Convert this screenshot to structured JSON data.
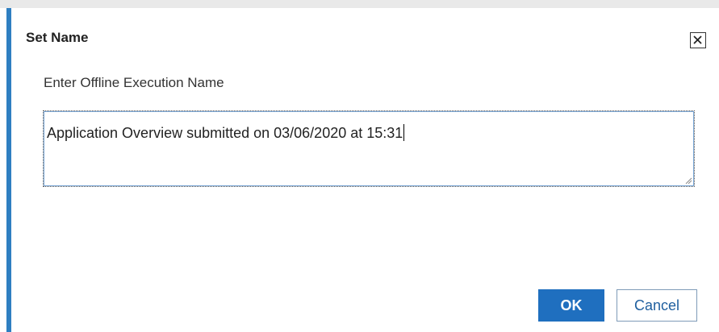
{
  "dialog": {
    "title": "Set Name",
    "close_icon": "close-icon"
  },
  "form": {
    "prompt_label": "Enter Offline Execution Name",
    "name_value": "Application Overview submitted on 03/06/2020 at 15:31"
  },
  "buttons": {
    "ok_label": "OK",
    "cancel_label": "Cancel"
  },
  "colors": {
    "accent": "#2f7fc1",
    "primary_button": "#1f6fbf"
  }
}
